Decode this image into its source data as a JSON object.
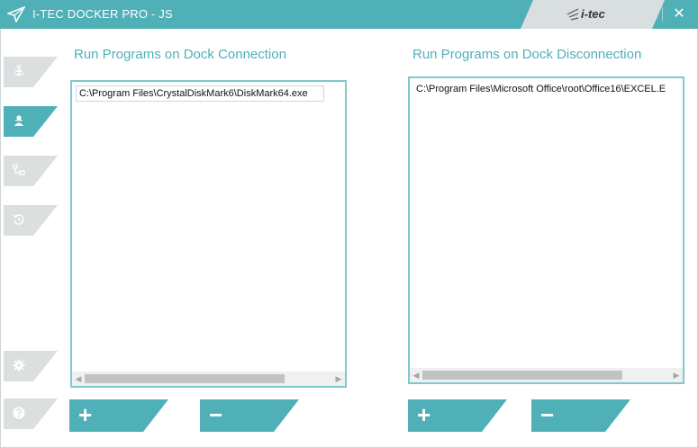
{
  "window": {
    "title": "I-TEC DOCKER PRO - JS",
    "brand": "i-tec",
    "close_glyph": "✕"
  },
  "sidebar": {
    "items": [
      {
        "icon": "anchor-icon",
        "active": false
      },
      {
        "icon": "user-icon",
        "active": true
      },
      {
        "icon": "network-icon",
        "active": false
      },
      {
        "icon": "history-icon",
        "active": false
      },
      {
        "icon": "gear-icon",
        "active": false
      },
      {
        "icon": "help-icon",
        "active": false
      }
    ]
  },
  "connect": {
    "title": "Run Programs on Dock Connection",
    "items": [
      "C:\\Program Files\\CrystalDiskMark6\\DiskMark64.exe"
    ],
    "add_label": "+",
    "remove_label": "−"
  },
  "disconnect": {
    "title": "Run Programs on Dock Disconnection",
    "items": [
      "C:\\Program Files\\Microsoft Office\\root\\Office16\\EXCEL.E"
    ],
    "add_label": "+",
    "remove_label": "−"
  },
  "colors": {
    "accent": "#4fb0b8",
    "tab_inactive": "#dcdfe0"
  }
}
